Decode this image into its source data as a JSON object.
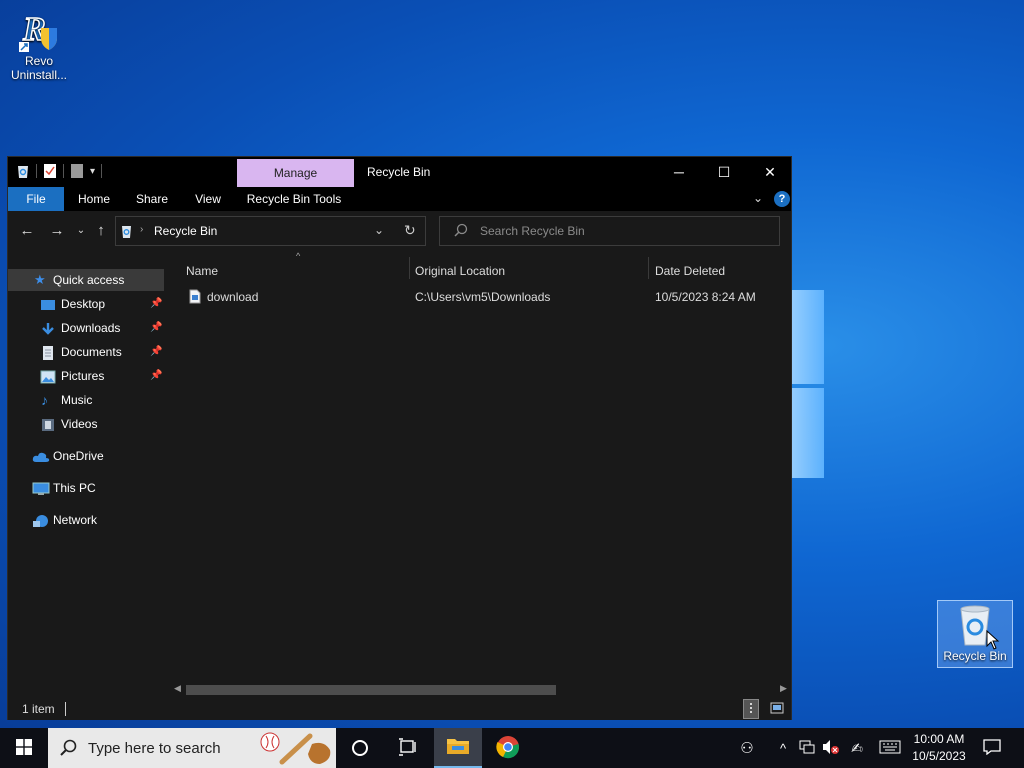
{
  "desktop": {
    "icons": [
      {
        "label": "Revo Uninstall..."
      },
      {
        "label": "Recycle Bin"
      }
    ]
  },
  "window": {
    "title": "Recycle Bin",
    "context_tab": "Manage",
    "ribbon_tabs": [
      "File",
      "Home",
      "Share",
      "View",
      "Recycle Bin Tools"
    ],
    "address": {
      "path": "Recycle Bin"
    },
    "search": {
      "placeholder": "Search Recycle Bin"
    },
    "nav": {
      "quick_access": "Quick access",
      "desktop": "Desktop",
      "downloads": "Downloads",
      "documents": "Documents",
      "pictures": "Pictures",
      "music": "Music",
      "videos": "Videos",
      "onedrive": "OneDrive",
      "this_pc": "This PC",
      "network": "Network"
    },
    "columns": [
      "Name",
      "Original Location",
      "Date Deleted"
    ],
    "rows": [
      {
        "name": "download",
        "original_location": "C:\\Users\\vm5\\Downloads",
        "date_deleted": "10/5/2023 8:24 AM"
      }
    ],
    "status": {
      "item_count": "1 item"
    }
  },
  "taskbar": {
    "search_placeholder": "Type here to search",
    "clock": {
      "time": "10:00 AM",
      "date": "10/5/2023"
    }
  },
  "colors": {
    "accent": "#1b6fc1",
    "manage_tab": "#d9b6f0",
    "window_bg": "#191919",
    "taskbar_bg": "#0d0f16"
  }
}
